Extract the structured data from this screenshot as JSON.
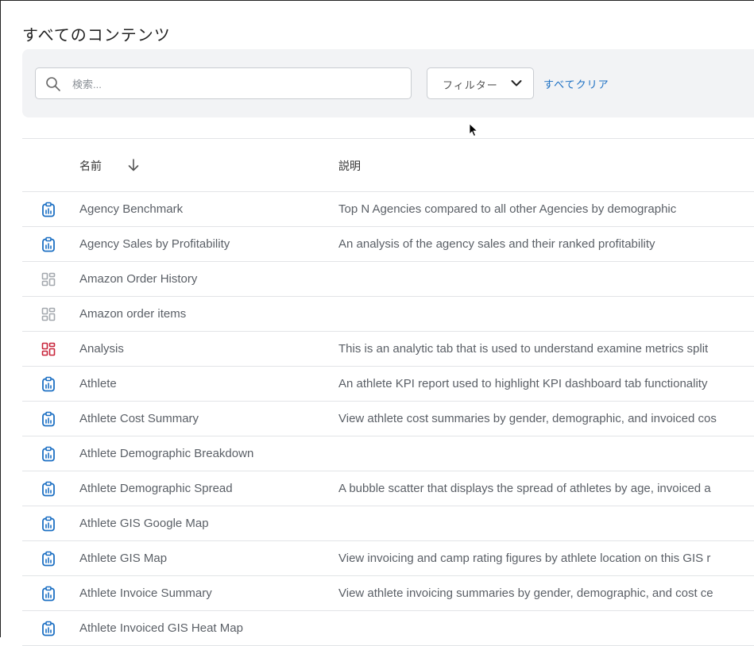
{
  "page_title": "すべてのコンテンツ",
  "toolbar": {
    "search_placeholder": "検索...",
    "filter_label": "フィルター",
    "clear_all_label": "すべてクリア"
  },
  "table": {
    "columns": {
      "name": "名前",
      "description": "説明"
    },
    "sort": {
      "column": "name",
      "direction": "descending-arrow"
    },
    "rows": [
      {
        "icon": "report-icon",
        "name": "Agency Benchmark",
        "description": "Top N Agencies compared to all other Agencies by demographic"
      },
      {
        "icon": "report-icon",
        "name": "Agency Sales by Profitability",
        "description": "An analysis of the agency sales and their ranked profitability"
      },
      {
        "icon": "dashboard-gray-icon",
        "name": "Amazon Order History",
        "description": ""
      },
      {
        "icon": "dashboard-gray-icon",
        "name": "Amazon order items",
        "description": ""
      },
      {
        "icon": "dashboard-red-icon",
        "name": "Analysis",
        "description": "This is an analytic tab that is used to understand examine metrics split"
      },
      {
        "icon": "report-icon",
        "name": "Athlete",
        "description": "An athlete KPI report used to highlight KPI dashboard tab functionality"
      },
      {
        "icon": "report-icon",
        "name": "Athlete Cost Summary",
        "description": "View athlete cost summaries by gender, demographic, and invoiced cos"
      },
      {
        "icon": "report-icon",
        "name": "Athlete Demographic Breakdown",
        "description": ""
      },
      {
        "icon": "report-icon",
        "name": "Athlete Demographic Spread",
        "description": "A bubble scatter that displays the spread of athletes by age, invoiced a"
      },
      {
        "icon": "report-icon",
        "name": "Athlete GIS Google Map",
        "description": ""
      },
      {
        "icon": "report-icon",
        "name": "Athlete GIS Map",
        "description": "View invoicing and camp rating figures by athlete location on this GIS r"
      },
      {
        "icon": "report-icon",
        "name": "Athlete Invoice Summary",
        "description": "View athlete invoicing summaries by gender, demographic, and cost ce"
      },
      {
        "icon": "report-icon",
        "name": "Athlete Invoiced GIS Heat Map",
        "description": ""
      }
    ]
  },
  "colors": {
    "report_icon": "#1b6fc3",
    "dashboard_gray_icon": "#a3a8ae",
    "dashboard_red_icon": "#c8243a",
    "link": "#1b6fc3"
  }
}
